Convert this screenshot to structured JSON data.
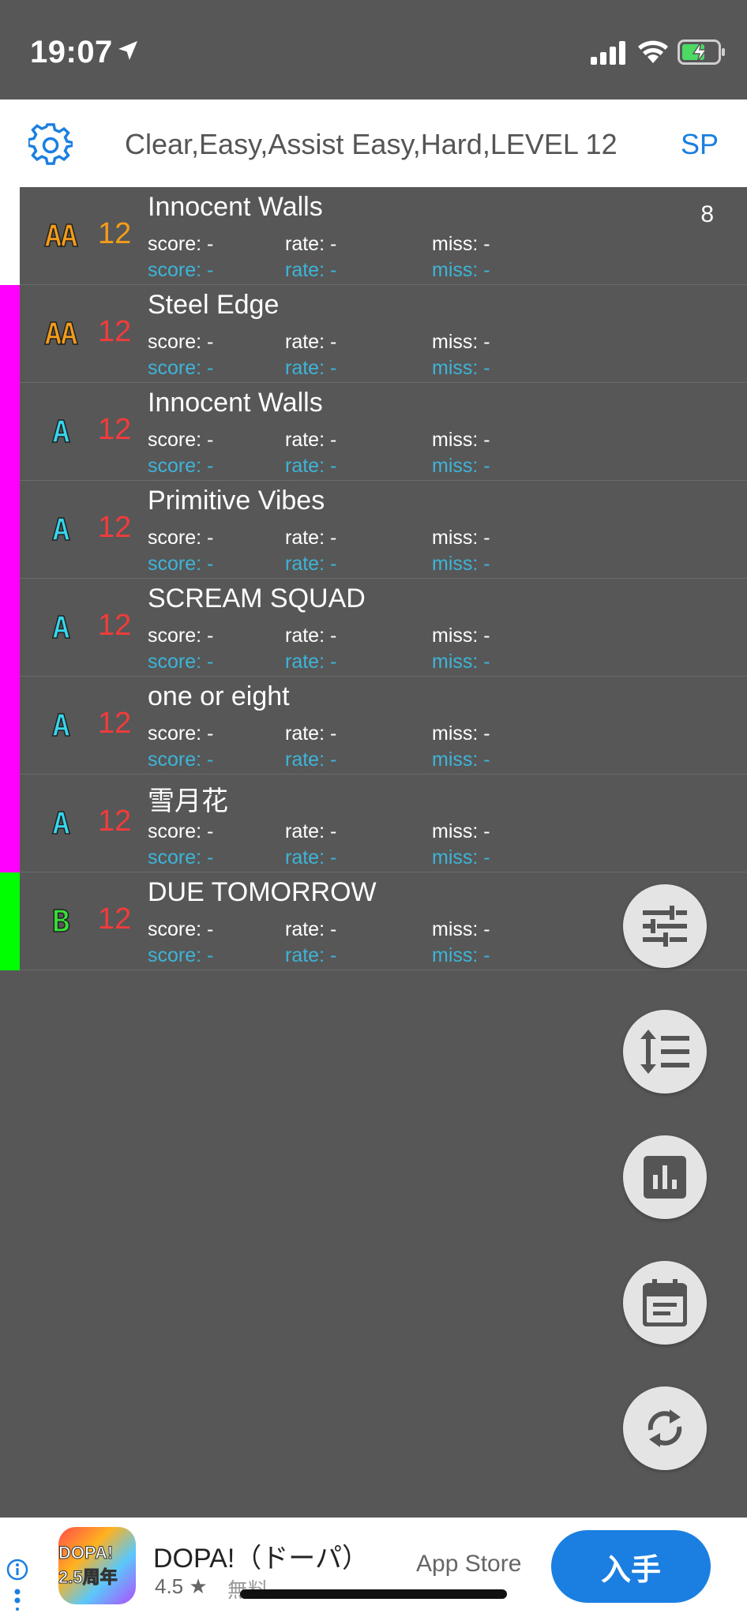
{
  "status": {
    "time": "19:07"
  },
  "header": {
    "filter": "Clear,Easy,Assist Easy,Hard,LEVEL 12",
    "mode": "SP"
  },
  "colors": {
    "pink": "#ff00ff",
    "green": "#00ff00",
    "grade_orange": "#f39c1a",
    "grade_cyan": "#36d6ec",
    "grade_green": "#37e037",
    "level_orange": "#f39c1a",
    "level_red": "#f23b3b"
  },
  "labels": {
    "score": "score: -",
    "rate": "rate: -",
    "miss": "miss: -"
  },
  "songs": [
    {
      "grade": "AA",
      "level": "12",
      "title": "Innocent Walls",
      "count": "8"
    },
    {
      "grade": "AA",
      "level": "12",
      "title": "Steel Edge"
    },
    {
      "grade": "A",
      "level": "12",
      "title": "Innocent Walls"
    },
    {
      "grade": "A",
      "level": "12",
      "title": "Primitive Vibes"
    },
    {
      "grade": "A",
      "level": "12",
      "title": "SCREAM SQUAD"
    },
    {
      "grade": "A",
      "level": "12",
      "title": "one or eight"
    },
    {
      "grade": "A",
      "level": "12",
      "title": "雪月花"
    },
    {
      "grade": "B",
      "level": "12",
      "title": "DUE TOMORROW"
    }
  ],
  "ad": {
    "icon_text": "DOPA! 2.5周年",
    "title": "DOPA!（ドーパ）",
    "rating": "4.5 ★",
    "price": "無料",
    "store": "App Store",
    "button": "入手"
  }
}
